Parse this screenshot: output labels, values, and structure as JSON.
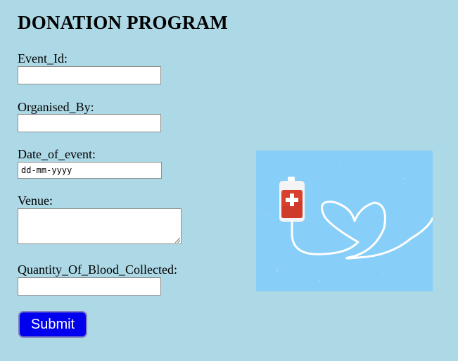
{
  "form": {
    "title": "DONATION PROGRAM",
    "fields": [
      {
        "label": "Event_Id:",
        "value": ""
      },
      {
        "label": "Organised_By:",
        "value": ""
      },
      {
        "label": "Date_of_event:",
        "placeholder": "dd-mm-yyyy"
      },
      {
        "label": "Venue:",
        "value": ""
      },
      {
        "label": "Quantity_Of_Blood_Collected:",
        "value": ""
      }
    ],
    "submit_label": "Submit"
  },
  "illustration": {
    "icon": "blood-bag-heart-icon",
    "background_color": "#87cef8",
    "bag_color": "#d9412f"
  },
  "colors": {
    "page_background": "#add8e6",
    "submit_button": "#0000ee"
  }
}
